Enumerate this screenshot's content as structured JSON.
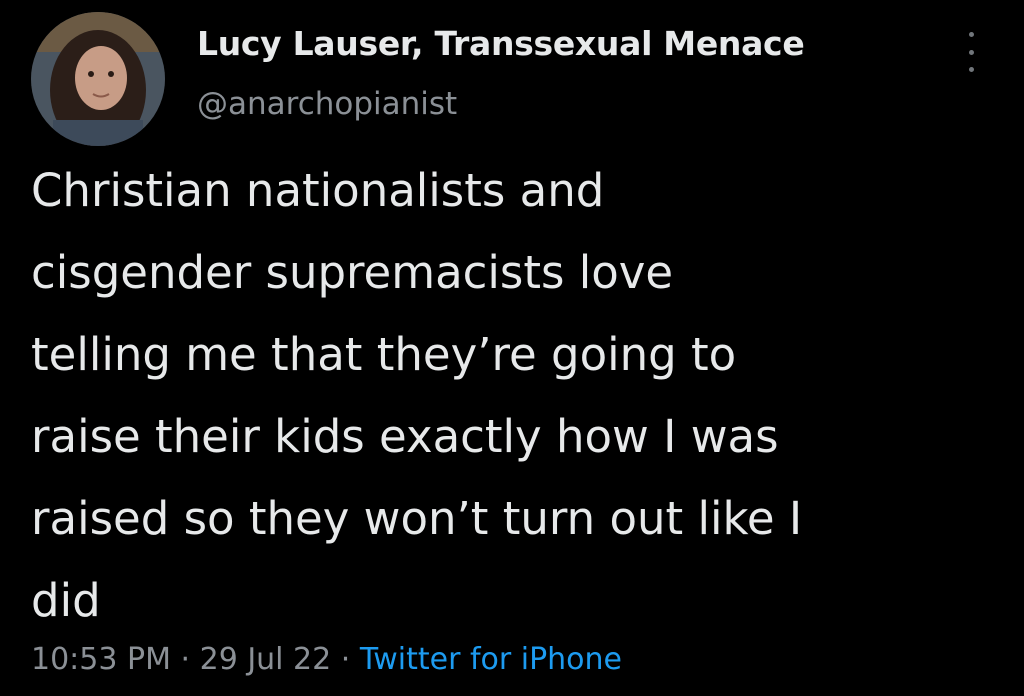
{
  "tweet": {
    "display_name": "Lucy Lauser, Transsexual Menace",
    "handle": "@anarchopianist",
    "text_lines": [
      "Christian nationalists and",
      "cisgender supremacists love",
      "telling me that they’re going to",
      "raise their kids exactly how I was",
      "raised so they won’t turn out like I",
      "did"
    ],
    "time": "10:53 PM",
    "date": "29 Jul 22",
    "separator": "·",
    "source": "Twitter for iPhone"
  },
  "icons": {
    "more": "more-vertical-icon"
  },
  "colors": {
    "background": "#000000",
    "text": "#e7e9ea",
    "secondary": "#8b9096",
    "link": "#1d9bf0"
  }
}
